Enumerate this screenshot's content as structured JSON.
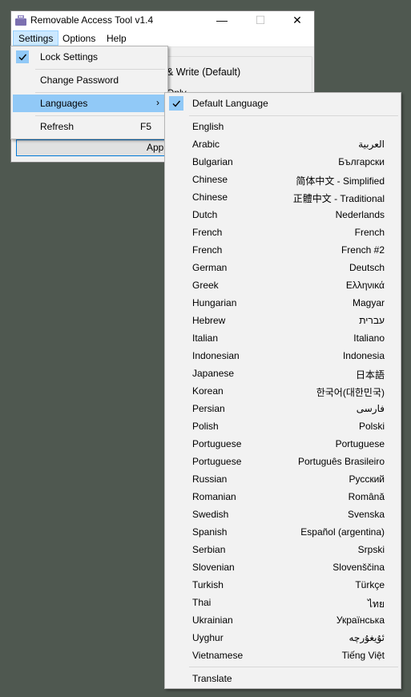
{
  "window": {
    "title": "Removable Access Tool v1.4",
    "controls": {
      "minimize": "—",
      "maximize": "☐",
      "close": "✕"
    },
    "menubar": [
      "Settings",
      "Options",
      "Help"
    ],
    "rw_label": "& Write (Default)",
    "only_label": "Only",
    "apply_label": "Apply C"
  },
  "settings_menu": {
    "lock": "Lock Settings",
    "change_password": "Change Password",
    "languages": "Languages",
    "refresh": "Refresh",
    "refresh_shortcut": "F5"
  },
  "languages_menu": {
    "default": "Default Language",
    "items": [
      {
        "name": "English",
        "native": ""
      },
      {
        "name": "Arabic",
        "native": "العربية"
      },
      {
        "name": "Bulgarian",
        "native": "Български"
      },
      {
        "name": "Chinese",
        "native": "简体中文 - Simplified"
      },
      {
        "name": "Chinese",
        "native": "正體中文 - Traditional"
      },
      {
        "name": "Dutch",
        "native": "Nederlands"
      },
      {
        "name": "French",
        "native": "French"
      },
      {
        "name": "French",
        "native": "French #2"
      },
      {
        "name": "German",
        "native": "Deutsch"
      },
      {
        "name": "Greek",
        "native": "Ελληνικά"
      },
      {
        "name": "Hungarian",
        "native": "Magyar"
      },
      {
        "name": "Hebrew",
        "native": "עברית"
      },
      {
        "name": "Italian",
        "native": "Italiano"
      },
      {
        "name": "Indonesian",
        "native": "Indonesia"
      },
      {
        "name": "Japanese",
        "native": "日本語"
      },
      {
        "name": "Korean",
        "native": "한국어(대한민국)"
      },
      {
        "name": "Persian",
        "native": "فارسی"
      },
      {
        "name": "Polish",
        "native": "Polski"
      },
      {
        "name": "Portuguese",
        "native": "Portuguese"
      },
      {
        "name": "Portuguese",
        "native": "Português Brasileiro"
      },
      {
        "name": "Russian",
        "native": "Русский"
      },
      {
        "name": "Romanian",
        "native": "Română"
      },
      {
        "name": "Swedish",
        "native": "Svenska"
      },
      {
        "name": "Spanish",
        "native": "Español (argentina)"
      },
      {
        "name": "Serbian",
        "native": "Srpski"
      },
      {
        "name": "Slovenian",
        "native": "Slovenščina"
      },
      {
        "name": "Turkish",
        "native": "Türkçe"
      },
      {
        "name": "Thai",
        "native": "ไทย"
      },
      {
        "name": "Ukrainian",
        "native": "Українська"
      },
      {
        "name": "Uyghur",
        "native": "ئۇيغۇرچە"
      },
      {
        "name": "Vietnamese",
        "native": "Tiếng Việt"
      }
    ],
    "translate": "Translate"
  },
  "colors": {
    "highlight": "#91c9f7",
    "desktop": "#4f5850",
    "menu_bg": "#f2f2f2"
  }
}
